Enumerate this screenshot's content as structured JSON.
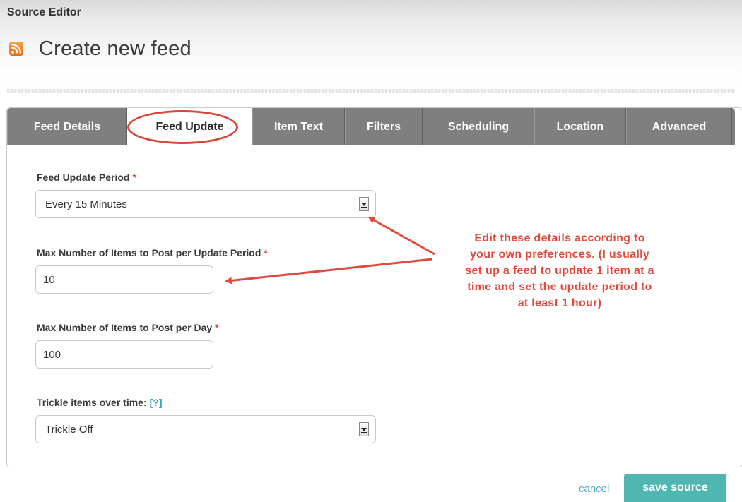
{
  "header": {
    "app_title": "Source Editor",
    "page_title": "Create new feed",
    "icon": "rss-feed-icon"
  },
  "tabs": [
    {
      "label": "Feed Details",
      "active": false
    },
    {
      "label": "Feed Update",
      "active": true
    },
    {
      "label": "Item Text",
      "active": false
    },
    {
      "label": "Filters",
      "active": false
    },
    {
      "label": "Scheduling",
      "active": false
    },
    {
      "label": "Location",
      "active": false
    },
    {
      "label": "Advanced",
      "active": false
    }
  ],
  "form": {
    "update_period": {
      "label": "Feed Update Period",
      "required_mark": "*",
      "value": "Every 15 Minutes"
    },
    "max_items_per_period": {
      "label": "Max Number of Items to Post per Update Period",
      "required_mark": "*",
      "value": "10"
    },
    "max_items_per_day": {
      "label": "Max Number of Items to Post per Day",
      "required_mark": "*",
      "value": "100"
    },
    "trickle": {
      "label": "Trickle items over time:",
      "help_link": "[?]",
      "value": "Trickle Off"
    }
  },
  "annotation": {
    "lines": [
      "Edit these details according to",
      "your own preferences.  (I usually",
      "set up a feed to update 1 item at a",
      "time and set the update period to",
      "at least 1 hour)"
    ],
    "color": "#e04a3c"
  },
  "footer": {
    "cancel_label": "cancel",
    "save_label": "save source"
  },
  "colors": {
    "tab_bar": "#7f7f7f",
    "save_button": "#4fb6b1",
    "link": "#4ba9cc",
    "required": "#d9463b"
  }
}
